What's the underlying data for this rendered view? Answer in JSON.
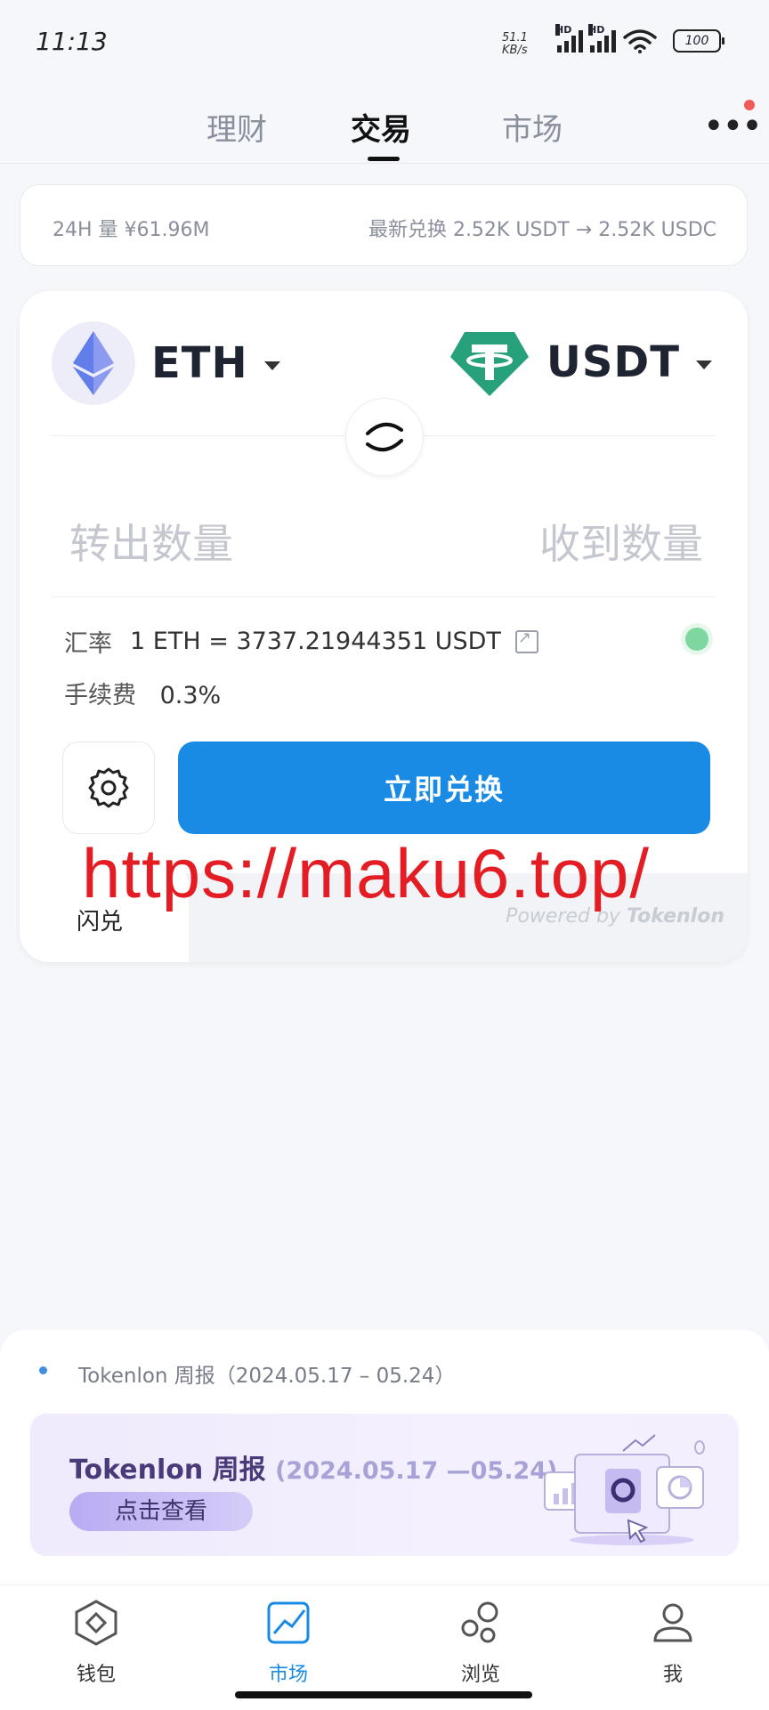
{
  "status_bar": {
    "time": "11:13",
    "net_speed_value": "51.1",
    "net_speed_unit": "KB/s",
    "signal_label": "HD",
    "battery": "100"
  },
  "tabs": [
    {
      "label": "理财",
      "active": false
    },
    {
      "label": "交易",
      "active": true
    },
    {
      "label": "市场",
      "active": false
    }
  ],
  "ticker": {
    "volume": "24H 量 ¥61.96M",
    "latest": "最新兑换 2.52K USDT → 2.52K USDC"
  },
  "swap": {
    "from_token": "ETH",
    "to_token": "USDT",
    "amount_out_placeholder": "转出数量",
    "amount_in_placeholder": "收到数量",
    "rate_label": "汇率",
    "rate_value": "1 ETH = 3737.21944351 USDT",
    "fee_label": "手续费",
    "fee_value": "0.3%",
    "swap_button": "立即兑换",
    "footer_tab": "闪兑",
    "powered_by": "Powered by",
    "powered_brand": "Tokenlon"
  },
  "watermark": "https://maku6.top/",
  "news": {
    "line": "Tokenlon 周报（2024.05.17 – 05.24）",
    "banner_title": "Tokenlon 周报",
    "banner_dates": "(2024.05.17 —05.24)",
    "banner_button": "点击查看"
  },
  "bottom_nav": [
    {
      "label": "钱包",
      "icon": "wallet-icon",
      "active": false
    },
    {
      "label": "市场",
      "icon": "market-icon",
      "active": true
    },
    {
      "label": "浏览",
      "icon": "browse-icon",
      "active": false
    },
    {
      "label": "我",
      "icon": "profile-icon",
      "active": false
    }
  ],
  "colors": {
    "accent": "#1a8be4",
    "eth": "#627eea",
    "usdt": "#26a17b",
    "watermark": "#e31d23",
    "live": "#7fd7a0"
  }
}
